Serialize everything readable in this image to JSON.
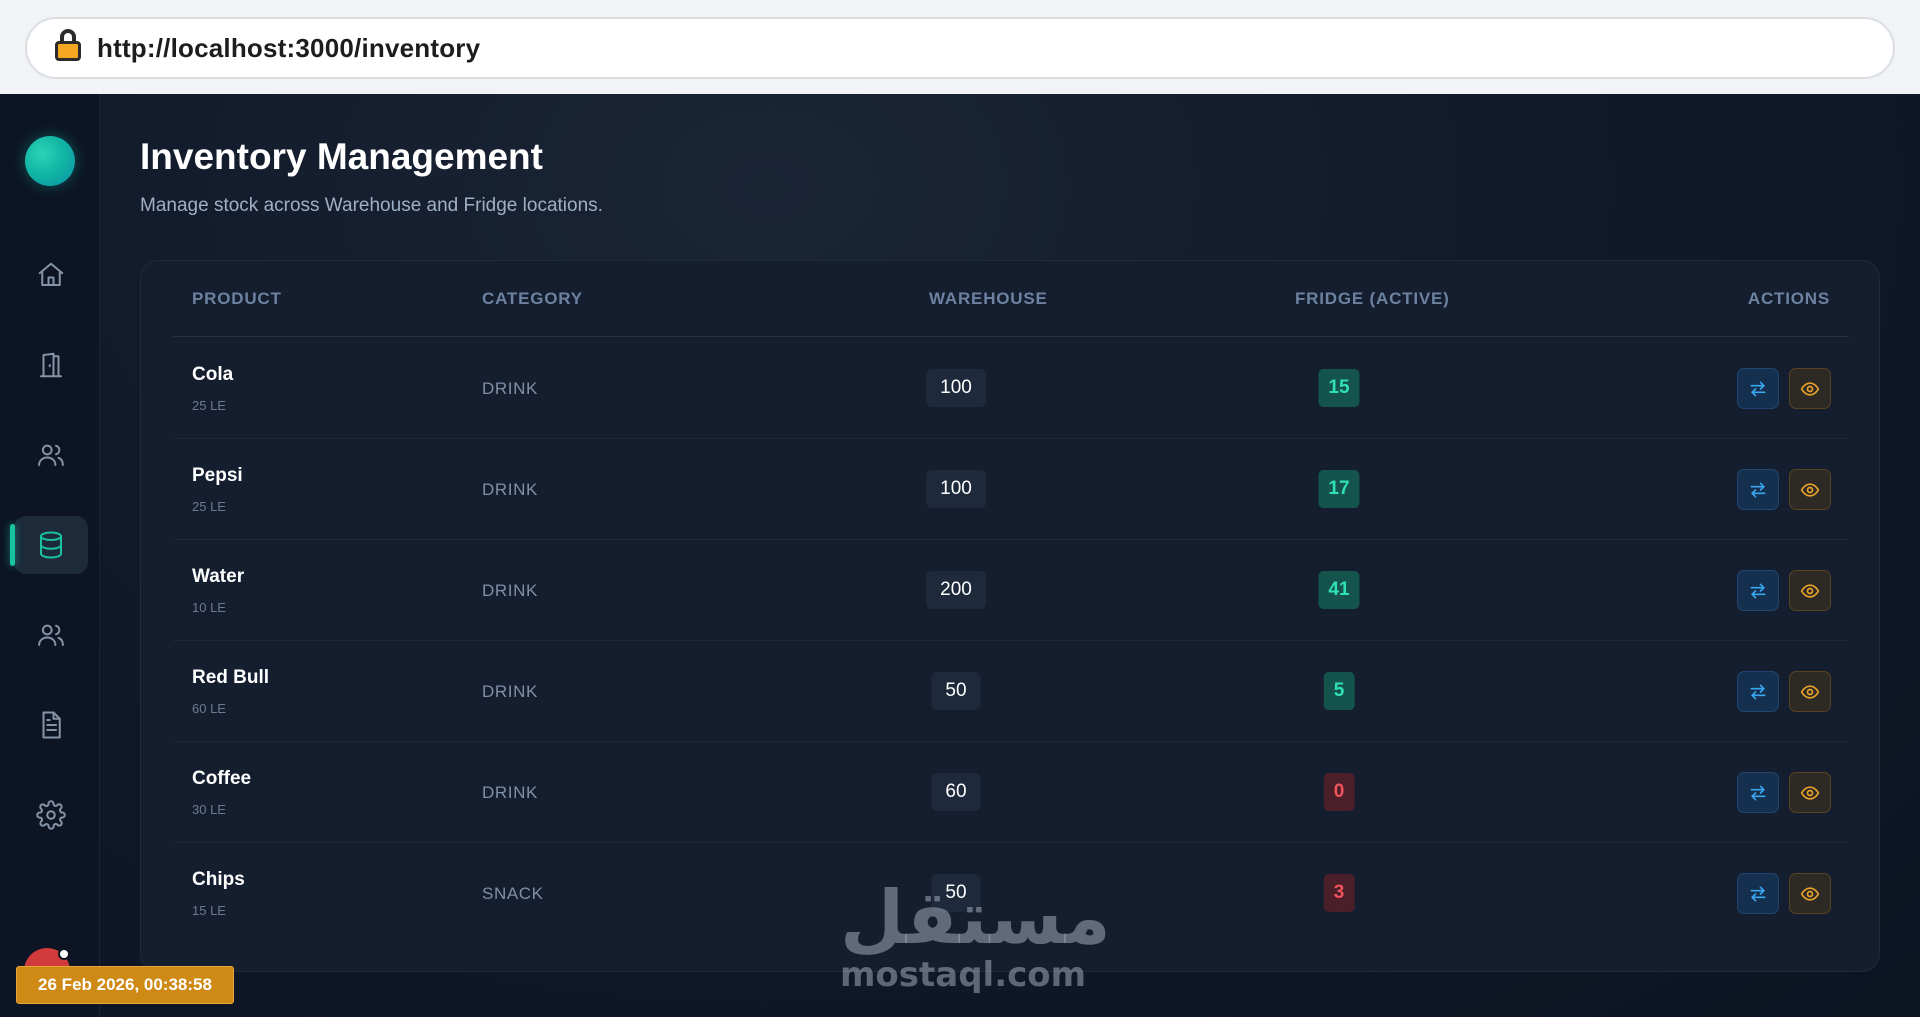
{
  "browser": {
    "url": "http://localhost:3000/inventory"
  },
  "sidebar": {
    "items": [
      {
        "icon": "home-icon",
        "active": false
      },
      {
        "icon": "door-icon",
        "active": false
      },
      {
        "icon": "users-icon",
        "active": false
      },
      {
        "icon": "database-icon",
        "active": true
      },
      {
        "icon": "users-icon",
        "active": false
      },
      {
        "icon": "document-icon",
        "active": false
      },
      {
        "icon": "settings-icon",
        "active": false
      }
    ],
    "accent_color": "#19c2a0"
  },
  "timestamp": "26 Feb 2026, 00:38:58",
  "page": {
    "title": "Inventory Management",
    "subtitle": "Manage stock across Warehouse and Fridge locations."
  },
  "table": {
    "columns": {
      "product": "PRODUCT",
      "category": "CATEGORY",
      "warehouse": "WAREHOUSE",
      "fridge": "FRIDGE (ACTIVE)",
      "actions": "ACTIONS"
    },
    "rows": [
      {
        "name": "Cola",
        "price": "25 LE",
        "category": "DRINK",
        "warehouse": "100",
        "fridge": "15",
        "fridge_status": "ok"
      },
      {
        "name": "Pepsi",
        "price": "25 LE",
        "category": "DRINK",
        "warehouse": "100",
        "fridge": "17",
        "fridge_status": "ok"
      },
      {
        "name": "Water",
        "price": "10 LE",
        "category": "DRINK",
        "warehouse": "200",
        "fridge": "41",
        "fridge_status": "ok"
      },
      {
        "name": "Red Bull",
        "price": "60 LE",
        "category": "DRINK",
        "warehouse": "50",
        "fridge": "5",
        "fridge_status": "ok"
      },
      {
        "name": "Coffee",
        "price": "30 LE",
        "category": "DRINK",
        "warehouse": "60",
        "fridge": "0",
        "fridge_status": "low"
      },
      {
        "name": "Chips",
        "price": "15 LE",
        "category": "SNACK",
        "warehouse": "50",
        "fridge": "3",
        "fridge_status": "low"
      }
    ]
  },
  "watermark": {
    "arabic": "مستقل",
    "latin": "mostaql.com"
  }
}
